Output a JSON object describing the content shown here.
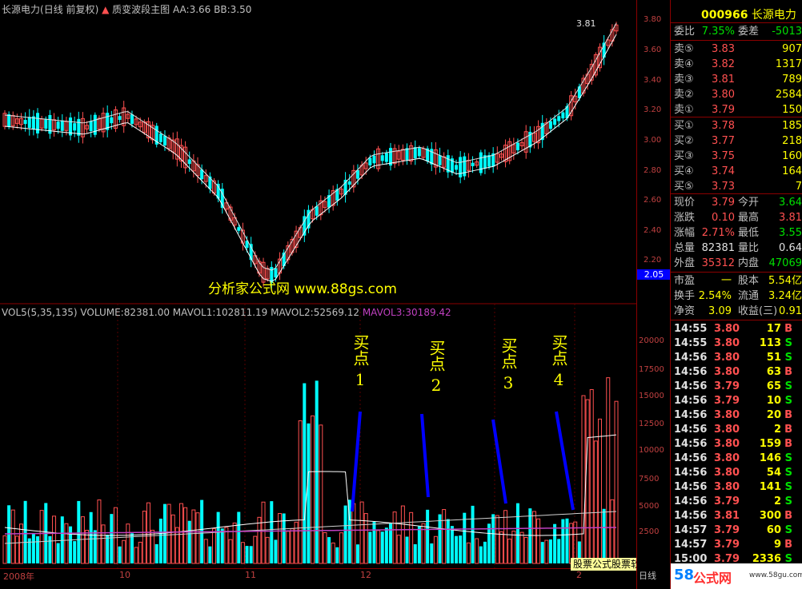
{
  "header": {
    "stock_name": "长源电力",
    "period": "日线",
    "adjust": "前复权",
    "indicator": "质变波段主图",
    "aa_label": "AA:",
    "aa_value": "3.66",
    "bb_label": "BB:",
    "bb_value": "3.50"
  },
  "price_axis": {
    "ticks": [
      "3.80",
      "3.60",
      "3.40",
      "3.20",
      "3.00",
      "2.80",
      "2.60",
      "2.40",
      "2.20",
      "2.05"
    ],
    "current_marker": "2.05",
    "high_marker": "3.81",
    "low_marker": "2.05"
  },
  "volume_panel": {
    "title": "VOL5(5,35,135)",
    "volume": "VOLUME:82381.00",
    "mavol1": "MAVOL1:102811.19",
    "mavol2": "MAVOL2:52569.12",
    "mavol3": "MAVOL3:30189.42",
    "axis_ticks": [
      "20000",
      "17500",
      "15000",
      "12500",
      "10000",
      "7500",
      "5000",
      "2500"
    ]
  },
  "date_axis": [
    "2008年",
    "10",
    "11",
    "12",
    "2"
  ],
  "watermark": "分析家公式网 www.88gs.com",
  "buy_points": [
    {
      "label": "买点",
      "num": "1"
    },
    {
      "label": "买点",
      "num": "2"
    },
    {
      "label": "买点",
      "num": "3"
    },
    {
      "label": "买点",
      "num": "4"
    }
  ],
  "quote": {
    "code": "000966",
    "name": "长源电力",
    "weibi_label": "委比",
    "weibi_value": "7.35%",
    "weicha_label": "委差",
    "weicha_value": "-5013",
    "asks": [
      {
        "label": "卖⑤",
        "price": "3.83",
        "vol": "907"
      },
      {
        "label": "卖④",
        "price": "3.82",
        "vol": "1317"
      },
      {
        "label": "卖③",
        "price": "3.81",
        "vol": "789"
      },
      {
        "label": "卖②",
        "price": "3.80",
        "vol": "2584"
      },
      {
        "label": "卖①",
        "price": "3.79",
        "vol": "150"
      }
    ],
    "bids": [
      {
        "label": "买①",
        "price": "3.78",
        "vol": "185"
      },
      {
        "label": "买②",
        "price": "3.77",
        "vol": "218"
      },
      {
        "label": "买③",
        "price": "3.75",
        "vol": "160"
      },
      {
        "label": "买④",
        "price": "3.74",
        "vol": "164"
      },
      {
        "label": "买⑤",
        "price": "3.73",
        "vol": "7"
      }
    ],
    "stats": [
      {
        "l1": "现价",
        "v1": "3.79",
        "c1": "red",
        "l2": "今开",
        "v2": "3.64",
        "c2": "green"
      },
      {
        "l1": "涨跌",
        "v1": "0.10",
        "c1": "red",
        "l2": "最高",
        "v2": "3.81",
        "c2": "red"
      },
      {
        "l1": "涨幅",
        "v1": "2.71%",
        "c1": "red",
        "l2": "最低",
        "v2": "3.55",
        "c2": "green"
      },
      {
        "l1": "总量",
        "v1": "82381",
        "c1": "white",
        "l2": "量比",
        "v2": "0.64",
        "c2": "white"
      },
      {
        "l1": "外盘",
        "v1": "35312",
        "c1": "red",
        "l2": "内盘",
        "v2": "47069",
        "c2": "green"
      }
    ],
    "fin": [
      {
        "l1": "市盈",
        "v1": "一",
        "l2": "股本",
        "v2": "5.54亿"
      },
      {
        "l1": "换手",
        "v1": "2.54%",
        "l2": "流通",
        "v2": "3.24亿"
      },
      {
        "l1": "净资",
        "v1": "3.09",
        "l2": "收益(三)",
        "v2": "0.91"
      }
    ],
    "trades": [
      {
        "t": "14:55",
        "p": "3.80",
        "v": "17",
        "d": "B"
      },
      {
        "t": "14:55",
        "p": "3.80",
        "v": "113",
        "d": "S"
      },
      {
        "t": "14:56",
        "p": "3.80",
        "v": "51",
        "d": "S"
      },
      {
        "t": "14:56",
        "p": "3.80",
        "v": "63",
        "d": "B"
      },
      {
        "t": "14:56",
        "p": "3.79",
        "v": "65",
        "d": "S"
      },
      {
        "t": "14:56",
        "p": "3.79",
        "v": "10",
        "d": "S"
      },
      {
        "t": "14:56",
        "p": "3.80",
        "v": "20",
        "d": "B"
      },
      {
        "t": "14:56",
        "p": "3.80",
        "v": "2",
        "d": "B"
      },
      {
        "t": "14:56",
        "p": "3.80",
        "v": "159",
        "d": "B"
      },
      {
        "t": "14:56",
        "p": "3.80",
        "v": "146",
        "d": "S"
      },
      {
        "t": "14:56",
        "p": "3.80",
        "v": "54",
        "d": "S"
      },
      {
        "t": "14:56",
        "p": "3.80",
        "v": "141",
        "d": "S"
      },
      {
        "t": "14:56",
        "p": "3.79",
        "v": "2",
        "d": "S"
      },
      {
        "t": "14:56",
        "p": "3.81",
        "v": "300",
        "d": "B"
      },
      {
        "t": "14:57",
        "p": "3.79",
        "v": "60",
        "d": "S"
      },
      {
        "t": "14:57",
        "p": "3.79",
        "v": "9",
        "d": "B"
      },
      {
        "t": "15:00",
        "p": "3.79",
        "v": "2336",
        "d": "S"
      }
    ]
  },
  "footer": {
    "banner": "股票公式股票软件下载",
    "day_tab": "日线",
    "brand_num": "58",
    "brand_text": "公式网",
    "brand_url": "www.58gu.com"
  },
  "colors": {
    "up": "#ff5050",
    "down": "#00ffff",
    "grid": "#8b0000",
    "text": "#c0c0c0",
    "accent": "#ffff00",
    "purple": "#c040c0"
  }
}
